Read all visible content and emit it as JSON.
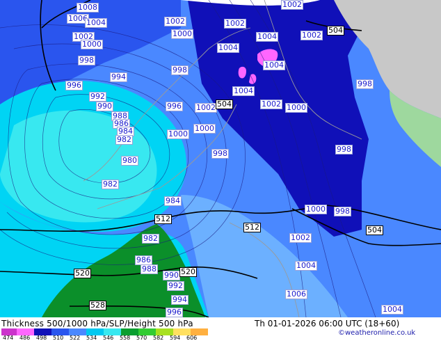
{
  "header": {
    "title": "Thickness 500/1000 hPa/SLP/Height 500 hPa",
    "timestamp": "Th 01-01-2026 06:00 UTC (18+60)",
    "credit": "©weatheronline.co.uk"
  },
  "legend": {
    "ticks": [
      "474",
      "486",
      "498",
      "510",
      "522",
      "534",
      "546",
      "558",
      "570",
      "582",
      "594",
      "606"
    ],
    "colors": [
      "#cc33cc",
      "#ff66ff",
      "#1010b8",
      "#2a55ee",
      "#4a88ff",
      "#00c8f0",
      "#38e8f0",
      "#0a9e30",
      "#33cc33",
      "#a8e020",
      "#ffe060",
      "#ffb040"
    ]
  },
  "map": {
    "background_colors": {
      "deep_blue": "#1010b8",
      "blue": "#2a55ee",
      "light_blue": "#4a88ff",
      "sky_blue": "#6cb0ff",
      "cyan": "#00d4f4",
      "aqua": "#38e8f0",
      "green": "#0b8f2a",
      "magenta": "#ff66ff",
      "land_grey": "#c8c8c8",
      "land_green": "#9ed89e",
      "white": "#ffffff"
    },
    "pressure_labels": [
      "1008",
      "1006",
      "1004",
      "1002",
      "1000",
      "998",
      "996",
      "994",
      "992",
      "990",
      "988",
      "986",
      "984",
      "982",
      "980",
      "982",
      "984",
      "986",
      "988",
      "990",
      "992",
      "994",
      "996",
      "998",
      "1000",
      "1002",
      "1002",
      "1002",
      "1004",
      "1004",
      "1004",
      "1002",
      "1000",
      "1000",
      "998",
      "996",
      "998",
      "1002",
      "1000",
      "998",
      "998",
      "1000",
      "1002",
      "1004",
      "1006",
      "1004",
      "1002",
      "1004",
      "1002",
      "1000",
      "1002",
      "982"
    ],
    "thickness_labels": [
      "504",
      "504",
      "512",
      "512",
      "504",
      "520",
      "520",
      "528"
    ]
  }
}
